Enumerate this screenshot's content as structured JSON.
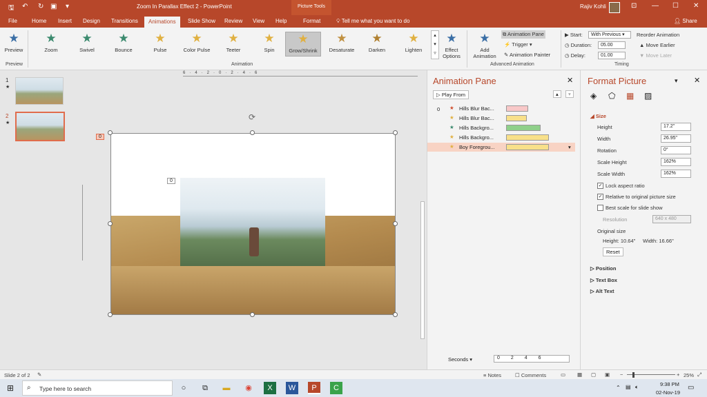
{
  "titlebar": {
    "doc_title": "Zoom In Parallax Effect 2 - PowerPoint",
    "context": "Picture Tools",
    "user": "Rajiv Kohli"
  },
  "tabs": [
    "File",
    "Home",
    "Insert",
    "Design",
    "Transitions",
    "Animations",
    "Slide Show",
    "Review",
    "View",
    "Help",
    "Format"
  ],
  "active_tab": "Animations",
  "tell_me": "Tell me what you want to do",
  "share": "Share",
  "ribbon": {
    "preview_label": "Preview",
    "preview_group": "Preview",
    "animations": [
      {
        "label": "Zoom",
        "color": "#3b8a6e"
      },
      {
        "label": "Swivel",
        "color": "#3b8a6e"
      },
      {
        "label": "Bounce",
        "color": "#3b8a6e"
      },
      {
        "label": "Pulse",
        "color": "#e0b040"
      },
      {
        "label": "Color Pulse",
        "color": "#e0b040"
      },
      {
        "label": "Teeter",
        "color": "#e0b040"
      },
      {
        "label": "Spin",
        "color": "#e0b040"
      },
      {
        "label": "Grow/Shrink",
        "color": "#e0b040"
      },
      {
        "label": "Desaturate",
        "color": "#c09040"
      },
      {
        "label": "Darken",
        "color": "#b08030"
      },
      {
        "label": "Lighten",
        "color": "#e0b040"
      }
    ],
    "animation_group": "Animation",
    "effect_options": "Effect Options",
    "add_animation": "Add Animation",
    "animation_pane": "Animation Pane",
    "trigger": "Trigger",
    "animation_painter": "Animation Painter",
    "advanced_group": "Advanced Animation",
    "start_label": "Start:",
    "start_value": "With Previous",
    "duration_label": "Duration:",
    "duration_value": "05.00",
    "delay_label": "Delay:",
    "delay_value": "01.00",
    "timing_group": "Timing",
    "reorder": "Reorder Animation",
    "move_earlier": "Move Earlier",
    "move_later": "Move Later"
  },
  "slides": [
    {
      "num": "1"
    },
    {
      "num": "2"
    }
  ],
  "canvas": {
    "tag0": "0",
    "tag1": "0"
  },
  "anim_pane": {
    "title": "Animation Pane",
    "play_from": "Play From",
    "index": "0",
    "rows": [
      {
        "name": "Hills Blur Bac...",
        "star": "#d05030",
        "bar": "#f8c8c8"
      },
      {
        "name": "Hills Blur Bac...",
        "star": "#e0b040",
        "bar": "#f8e08a"
      },
      {
        "name": "Hills Backgro...",
        "star": "#3b8a6e",
        "bar": "#8fd08a"
      },
      {
        "name": "Hills Backgro...",
        "star": "#e0b040",
        "bar": "#f8e08a"
      },
      {
        "name": "Boy Foregrou...",
        "star": "#e0b040",
        "bar": "#f8e08a"
      }
    ],
    "seconds": "Seconds",
    "timeline": [
      "0",
      "2",
      "4",
      "6"
    ]
  },
  "format_pane": {
    "title": "Format Picture",
    "size": "Size",
    "height_label": "Height",
    "height": "17.2\"",
    "width_label": "Width",
    "width": "26.95\"",
    "rotation_label": "Rotation",
    "rotation": "0°",
    "scale_h_label": "Scale Height",
    "scale_h": "162%",
    "scale_w_label": "Scale Width",
    "scale_w": "162%",
    "lock": "Lock aspect ratio",
    "relative": "Relative to original picture size",
    "best": "Best scale for slide show",
    "resolution_label": "Resolution",
    "resolution": "640 x 480",
    "original": "Original size",
    "orig_h": "Height:  10.64\"",
    "orig_w": "Width:  16.66\"",
    "reset": "Reset",
    "position": "Position",
    "textbox": "Text Box",
    "alt": "Alt Text"
  },
  "status": {
    "slide": "Slide 2 of 2",
    "notes": "Notes",
    "comments": "Comments",
    "zoom": "25%"
  },
  "taskbar": {
    "search": "Type here to search",
    "time": "9:38 PM",
    "date": "02-Nov-19"
  }
}
